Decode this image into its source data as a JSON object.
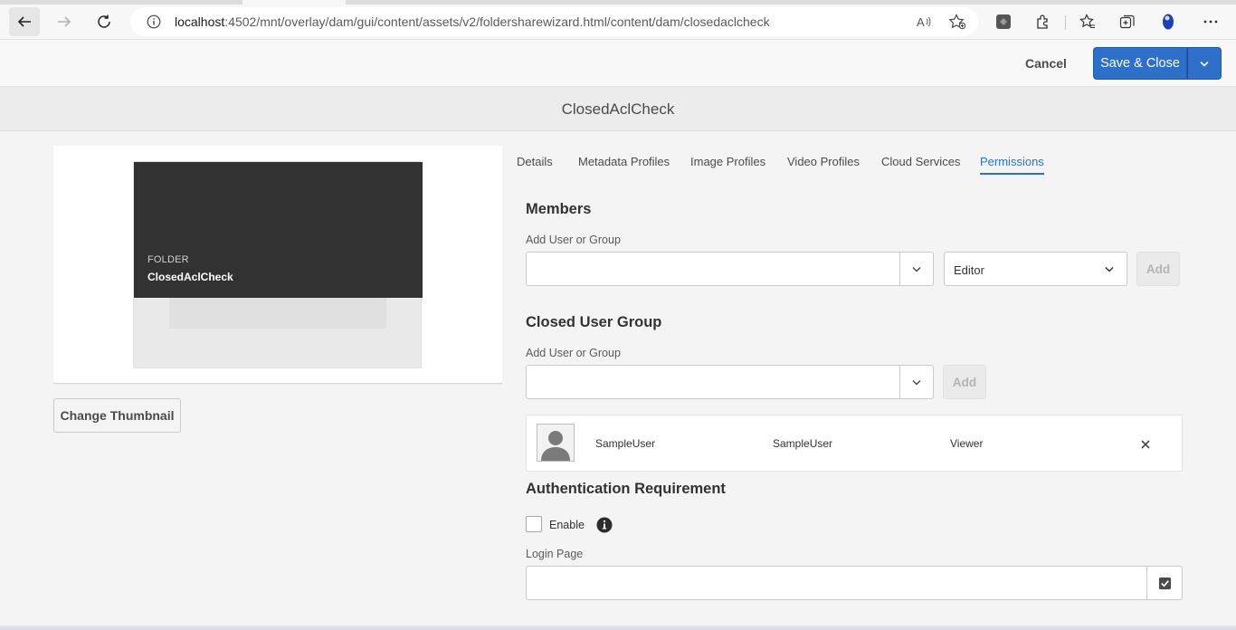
{
  "browser": {
    "url_host": "localhost",
    "url_rest": ":4502/mnt/overlay/dam/gui/content/assets/v2/foldersharewizard.html/content/dam/closedaclcheck"
  },
  "header": {
    "cancel_label": "Cancel",
    "save_label": "Save & Close"
  },
  "page": {
    "title": "ClosedAclCheck"
  },
  "thumbnail": {
    "type_label": "FOLDER",
    "name": "ClosedAclCheck",
    "change_label": "Change Thumbnail"
  },
  "tabs": [
    {
      "label": "Details",
      "active": false
    },
    {
      "label": "Metadata Profiles",
      "active": false
    },
    {
      "label": "Image Profiles",
      "active": false
    },
    {
      "label": "Video Profiles",
      "active": false
    },
    {
      "label": "Cloud Services",
      "active": false
    },
    {
      "label": "Permissions",
      "active": true
    }
  ],
  "members": {
    "heading": "Members",
    "field_label": "Add User or Group",
    "input_value": "",
    "role_value": "Editor",
    "add_label": "Add"
  },
  "cug": {
    "heading": "Closed User Group",
    "field_label": "Add User or Group",
    "input_value": "",
    "add_label": "Add",
    "rows": [
      {
        "name": "SampleUser",
        "id": "SampleUser",
        "role": "Viewer"
      }
    ]
  },
  "auth": {
    "heading": "Authentication Requirement",
    "enable_label": "Enable",
    "enable_checked": false,
    "login_label": "Login Page",
    "login_value": ""
  },
  "colors": {
    "accent": "#2d6fc9",
    "background": "#f4f4f4"
  }
}
